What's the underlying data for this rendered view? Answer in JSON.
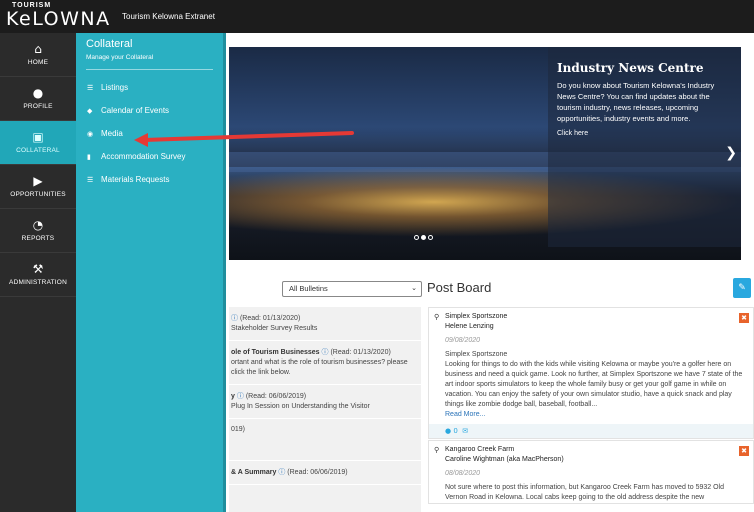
{
  "header": {
    "logo_small": "TOURISM",
    "logo_big": "KeLOWNA",
    "app_title": "Tourism Kelowna Extranet"
  },
  "nav": {
    "items": [
      {
        "label": "HOME",
        "icon": "home-icon"
      },
      {
        "label": "PROFILE",
        "icon": "user-icon"
      },
      {
        "label": "COLLATERAL",
        "icon": "image-icon",
        "active": true
      },
      {
        "label": "OPPORTUNITIES",
        "icon": "megaphone-icon"
      },
      {
        "label": "REPORTS",
        "icon": "pie-chart-icon"
      },
      {
        "label": "ADMINISTRATION",
        "icon": "wrench-icon"
      }
    ]
  },
  "flyout": {
    "title": "Collateral",
    "subtitle": "Manage your Collateral",
    "items": [
      {
        "label": "Listings",
        "icon": "list-icon"
      },
      {
        "label": "Calendar of Events",
        "icon": "tag-icon"
      },
      {
        "label": "Media",
        "icon": "camera-icon"
      },
      {
        "label": "Accommodation Survey",
        "icon": "document-icon"
      },
      {
        "label": "Materials Requests",
        "icon": "list-icon"
      }
    ]
  },
  "hero": {
    "title": "Industry News Centre",
    "body": "Do you know about Tourism Kelowna's Industry News Centre? You can find updates about the tourism industry, news releases, upcoming opportunities, industry events and more.",
    "cta": "Click here"
  },
  "bulletin_filter": {
    "selected": "All Bulletins"
  },
  "postboard": {
    "title": "Post Board"
  },
  "bulletins": [
    {
      "title": "",
      "read": "(Read: 01/13/2020)",
      "body": "Stakeholder Survey Results"
    },
    {
      "title": "ole of Tourism Businesses",
      "read": "(Read: 01/13/2020)",
      "body": "ortant and what is the role of tourism businesses? please click the link below."
    },
    {
      "title": "y",
      "read": "(Read: 06/06/2019)",
      "body": "Plug In Session on Understanding the Visitor"
    },
    {
      "title": "",
      "read": "",
      "body": "019)"
    },
    {
      "title": "& A Summary",
      "read": "(Read: 06/06/2019)",
      "body": ""
    }
  ],
  "posts": [
    {
      "org": "Simplex Sportszone",
      "author": "Helene Lenzing",
      "date": "09/08/2020",
      "heading": "Simplex Sportszone",
      "body": "Looking for things to do with the kids while visiting Kelowna or maybe you're a golfer here on business and need a quick game. Look no further, at Simplex Sportszone we have 7 state of the art indoor sports simulators to keep the whole family busy or get your golf game in while on vacation. You can enjoy the safety of your own simulator studio, have a quick snack and play things like zombie dodge ball, baseball, football...",
      "more": "Read More...",
      "comments": "0"
    },
    {
      "org": "Kangaroo Creek Farm",
      "author": "Caroline Wightman (aka MacPherson)",
      "date": "08/08/2020",
      "heading": "",
      "body": "Not sure where to post this information, but Kangaroo Creek Farm has moved to 5932 Old Vernon Road in Kelowna. Local cabs keep going to the old address despite the new",
      "more": "",
      "comments": ""
    }
  ]
}
